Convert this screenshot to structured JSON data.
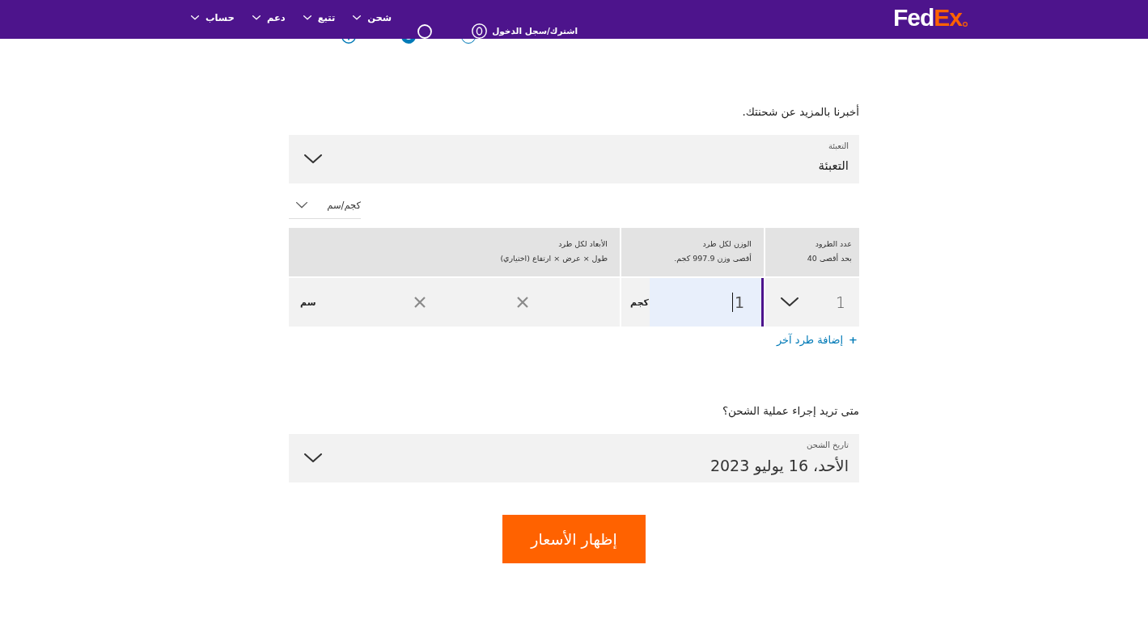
{
  "header": {
    "logo": {
      "first": "Fed",
      "second": "Ex"
    },
    "nav": [
      {
        "label": "شحن"
      },
      {
        "label": "تتبع"
      },
      {
        "label": "دعم"
      },
      {
        "label": "حساب"
      }
    ],
    "account": {
      "label": "اشترك/سجل الدخول"
    }
  },
  "previous_question": {
    "options": [
      {
        "selected": false
      },
      {
        "selected": true
      }
    ]
  },
  "package_section": {
    "heading": "أخبرنا بالمزيد عن شحنتك.",
    "packaging": {
      "label": "التعبئة",
      "value": "التعبئة"
    },
    "units": {
      "value": "كجم/سم"
    },
    "table": {
      "columns": [
        {
          "title": "عدد الطرود",
          "subtitle": "بحد أقصى 40"
        },
        {
          "title": "الوزن لكل طرد",
          "subtitle": "أقصى وزن 997.9 كجم."
        },
        {
          "title": "الأبعاد لكل طرد",
          "subtitle": "طول × عرض × ارتفاع (اختياري)"
        }
      ],
      "rows": [
        {
          "count": "1",
          "weight": {
            "value": "1",
            "unit": "كجم",
            "focused": true
          },
          "dimensions": {
            "unit": "سم"
          }
        }
      ]
    },
    "add_link": {
      "icon": "+",
      "label": "إضافة طرد آخر"
    }
  },
  "date_section": {
    "heading": "متى تريد إجراء عملية الشحن؟",
    "date": {
      "label": "تاريخ الشحن",
      "value": "الأحد، 16 يوليو 2023"
    }
  },
  "submit": {
    "label": "إظهار الأسعار"
  }
}
